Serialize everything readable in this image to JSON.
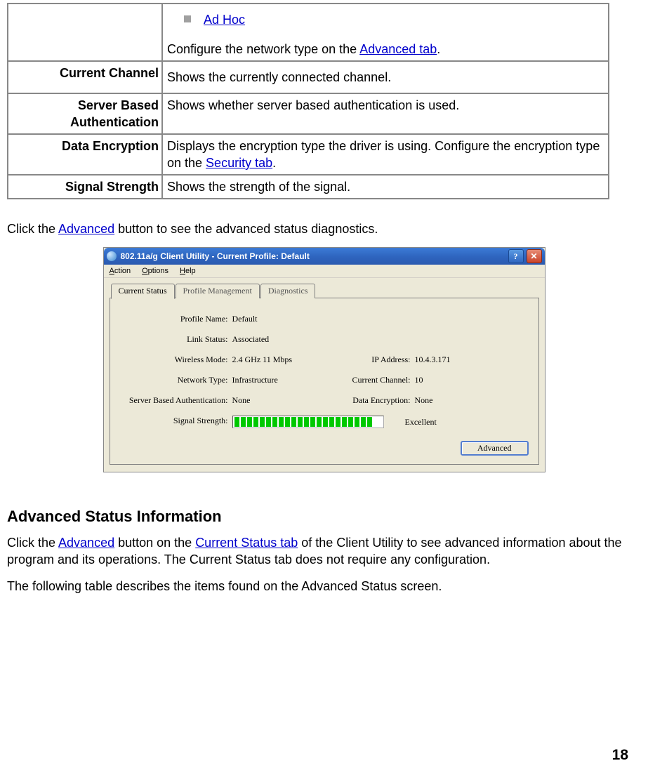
{
  "table1": {
    "rows": [
      {
        "label": "",
        "content_pre": "",
        "content_post": "Configure the network type on the ",
        "link_post_text": "Advanced tab",
        "suffix": ".",
        "bullet_link": "Ad Hoc"
      },
      {
        "label": "Current Channel",
        "content": "Shows the currently connected channel."
      },
      {
        "label": "Server Based Authentication",
        "content": "Shows whether server based authentication is used."
      },
      {
        "label": "Data Encryption",
        "pre": "Displays the encryption type the driver is using.    Configure the encryption type on the ",
        "link": "Security tab",
        "suffix": "."
      },
      {
        "label": "Signal Strength",
        "content": "Shows the strength of the signal."
      }
    ]
  },
  "para1": {
    "pre": "Click the ",
    "link": "Advanced",
    "post": " button to see the advanced status diagnostics."
  },
  "screenshot": {
    "title": "802.11a/g Client Utility - Current Profile: Default",
    "menu": {
      "action": "Action",
      "options": "Options",
      "help": "Help"
    },
    "tabs": {
      "current": "Current Status",
      "profile": "Profile Management",
      "diag": "Diagnostics"
    },
    "fields": {
      "profile_lbl": "Profile Name:",
      "profile_val": "Default",
      "link_lbl": "Link Status:",
      "link_val": "Associated",
      "mode_lbl": "Wireless Mode:",
      "mode_val": "2.4 GHz 11 Mbps",
      "ip_lbl": "IP Address:",
      "ip_val": "10.4.3.171",
      "nettype_lbl": "Network Type:",
      "nettype_val": "Infrastructure",
      "chan_lbl": "Current Channel:",
      "chan_val": "10",
      "auth_lbl": "Server Based Authentication:",
      "auth_val": "None",
      "enc_lbl": "Data Encryption:",
      "enc_val": "None",
      "sig_lbl": "Signal Strength:",
      "sig_val": "Excellent"
    },
    "button": "Advanced"
  },
  "heading": "Advanced Status Information",
  "para2": {
    "p1_pre": "Click the ",
    "p1_link1": "Advanced",
    "p1_mid": " button on the ",
    "p1_link2": "Current Status tab",
    "p1_post": " of the Client Utility to see advanced information about the program and its operations. The Current Status tab does not require any configuration.",
    "p2": "The following table describes the items found on the Advanced Status screen."
  },
  "page_num": "18"
}
